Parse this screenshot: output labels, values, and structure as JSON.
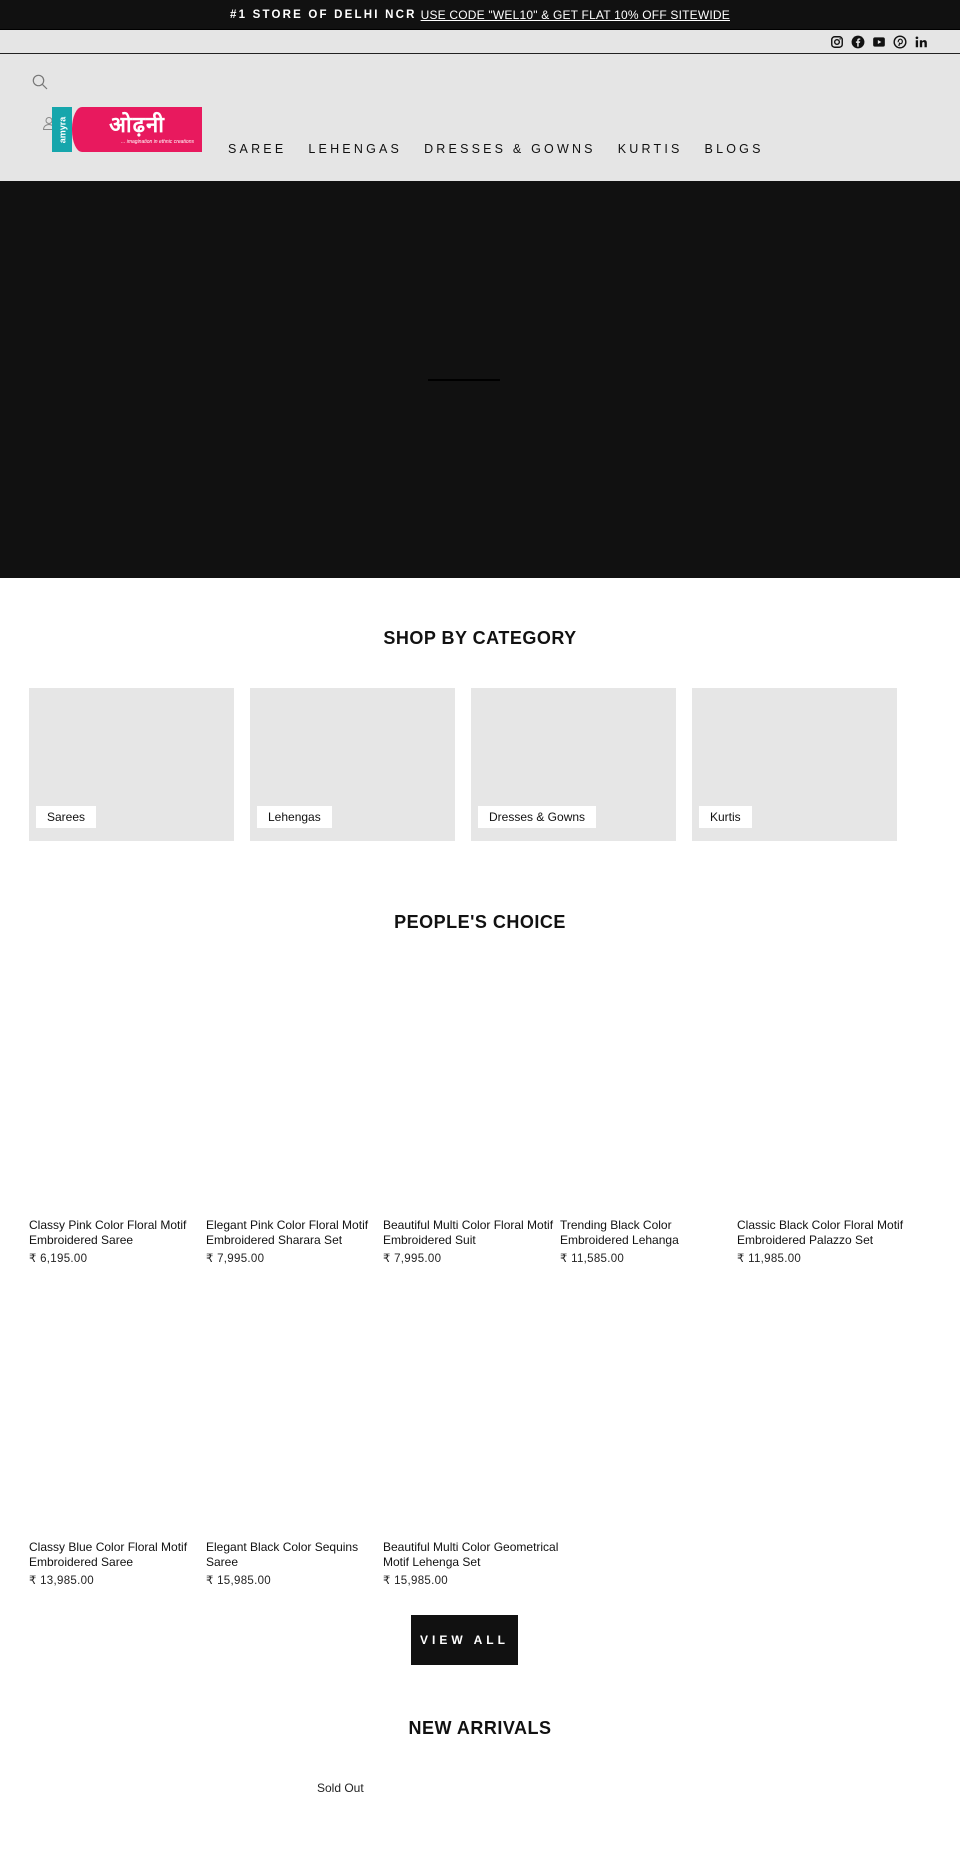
{
  "announcement": {
    "bold_text": "#1 STORE OF DELHI NCR",
    "link_text": "USE CODE \"WEL10\" & GET FLAT 10% OFF SITEWIDE"
  },
  "social_icons": [
    "instagram-icon",
    "facebook-icon",
    "youtube-icon",
    "pinterest-icon",
    "linkedin-icon"
  ],
  "header": {
    "logo": {
      "side_text": "amyra",
      "brand_text": "ओढ़नी",
      "tagline": "... imagination in ethnic creations",
      "colors": {
        "teal": "#16a6ac",
        "pink": "#e8195e"
      }
    },
    "nav": [
      {
        "label": "SAREE"
      },
      {
        "label": "LEHENGAS"
      },
      {
        "label": "DRESSES & GOWNS"
      },
      {
        "label": "KURTIS"
      },
      {
        "label": "BLOGS"
      }
    ]
  },
  "shop_by_category": {
    "title": "SHOP BY CATEGORY",
    "items": [
      {
        "label": "Sarees"
      },
      {
        "label": "Lehengas"
      },
      {
        "label": "Dresses & Gowns"
      },
      {
        "label": "Kurtis"
      }
    ]
  },
  "peoples_choice": {
    "title": "PEOPLE'S CHOICE",
    "products": [
      {
        "name": "Classy Pink Color Floral Motif Embroidered Saree",
        "price": "₹ 6,195.00"
      },
      {
        "name": "Elegant Pink Color Floral Motif Embroidered Sharara Set",
        "price": "₹ 7,995.00"
      },
      {
        "name": "Beautiful Multi Color Floral Motif Embroidered Suit",
        "price": "₹ 7,995.00"
      },
      {
        "name": "Trending Black Color Embroidered Lehanga",
        "price": "₹ 11,585.00"
      },
      {
        "name": "Classic Black Color Floral Motif Embroidered Palazzo Set",
        "price": "₹ 11,985.00"
      },
      {
        "name": "Classy Blue Color Floral Motif Embroidered Saree",
        "price": "₹ 13,985.00"
      },
      {
        "name": "Elegant Black Color Sequins Saree",
        "price": "₹ 15,985.00"
      },
      {
        "name": "Beautiful Multi Color Geometrical Motif Lehenga Set",
        "price": "₹ 15,985.00"
      }
    ],
    "view_all_label": "VIEW ALL"
  },
  "new_arrivals": {
    "title": "NEW ARRIVALS",
    "sold_out_label": "Sold Out"
  }
}
